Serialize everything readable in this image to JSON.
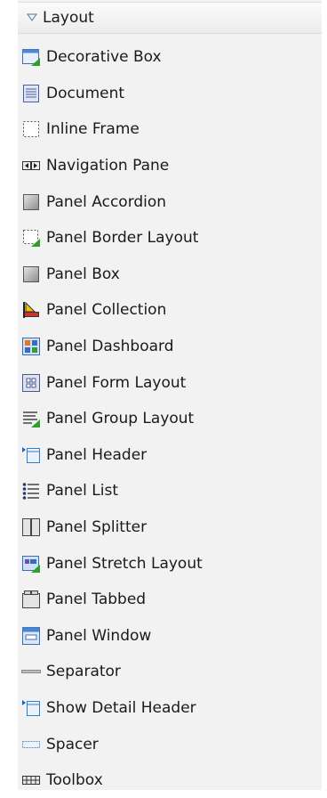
{
  "section": {
    "title": "Layout",
    "expanded_icon": "triangle-down-icon"
  },
  "items": [
    {
      "label": "Decorative Box",
      "icon": "decorative-box-icon"
    },
    {
      "label": "Document",
      "icon": "document-icon"
    },
    {
      "label": "Inline Frame",
      "icon": "inline-frame-icon"
    },
    {
      "label": "Navigation Pane",
      "icon": "navigation-pane-icon"
    },
    {
      "label": "Panel Accordion",
      "icon": "panel-accordion-icon"
    },
    {
      "label": "Panel Border Layout",
      "icon": "panel-border-layout-icon"
    },
    {
      "label": "Panel Box",
      "icon": "panel-box-icon"
    },
    {
      "label": "Panel Collection",
      "icon": "panel-collection-icon"
    },
    {
      "label": "Panel Dashboard",
      "icon": "panel-dashboard-icon"
    },
    {
      "label": "Panel Form Layout",
      "icon": "panel-form-layout-icon"
    },
    {
      "label": "Panel Group Layout",
      "icon": "panel-group-layout-icon"
    },
    {
      "label": "Panel Header",
      "icon": "panel-header-icon"
    },
    {
      "label": "Panel List",
      "icon": "panel-list-icon"
    },
    {
      "label": "Panel Splitter",
      "icon": "panel-splitter-icon"
    },
    {
      "label": "Panel Stretch Layout",
      "icon": "panel-stretch-layout-icon"
    },
    {
      "label": "Panel Tabbed",
      "icon": "panel-tabbed-icon"
    },
    {
      "label": "Panel Window",
      "icon": "panel-window-icon"
    },
    {
      "label": "Separator",
      "icon": "separator-icon"
    },
    {
      "label": "Show Detail Header",
      "icon": "show-detail-header-icon"
    },
    {
      "label": "Spacer",
      "icon": "spacer-icon"
    },
    {
      "label": "Toolbox",
      "icon": "toolbox-icon"
    }
  ]
}
